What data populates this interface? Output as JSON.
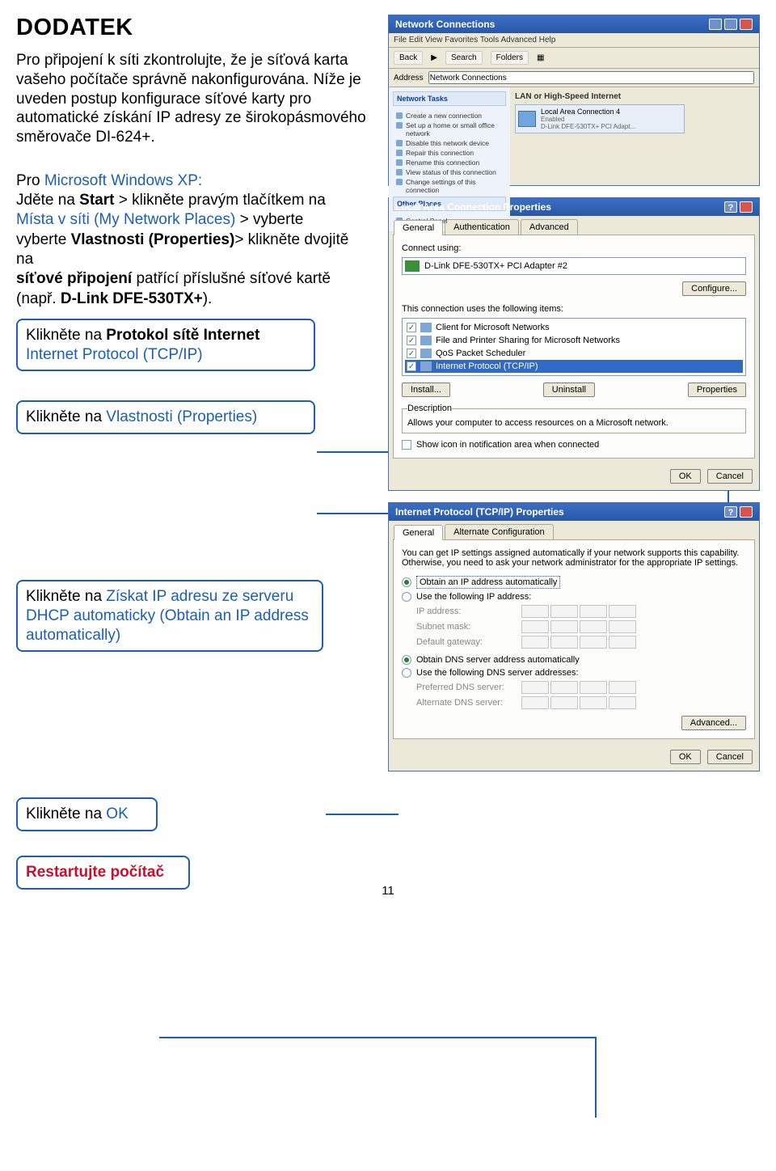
{
  "title": "DODATEK",
  "intro": "Pro připojení k síti zkontrolujte, že je síťová karta vašeho počítače správně nakonfigurována. Níže je uveden postup konfigurace síťové karty pro automatické získání IP adresy ze širokopásmového směrovače DI-624+.",
  "steps": {
    "prefix": "Pro ",
    "os": "Microsoft Windows XP:",
    "l1a": "Jděte na ",
    "start": "Start",
    "l1b": " > klikněte pravým tlačítkem na",
    "mynet": "Místa v síti (My Network Places)",
    "l2": " > vyberte ",
    "props": "Vlastnosti (Properties)",
    "l3": "> klikněte dvojitě na",
    "l4": "síťové připojení",
    "l5": " patřící příslušné síťové kartě (např. ",
    "dlink": "D-Link DFE-530TX+",
    "l6": ")."
  },
  "callouts": {
    "c1a": "Klikněte na ",
    "c1b": "Protokol sítě Internet",
    "c1c": "Internet Protocol (TCP/IP)",
    "c2a": "Klikněte na ",
    "c2b": "Vlastnosti (Properties)",
    "c3a": "Klikněte na ",
    "c3b": "Získat IP adresu ze serveru DHCP automaticky (Obtain an IP address automatically)",
    "c4a": "Klikněte na ",
    "c4b": "OK",
    "c5": "Restartujte počítač"
  },
  "pageno": "11",
  "nc": {
    "title": "Network Connections",
    "menu": "File   Edit   View   Favorites   Tools   Advanced   Help",
    "back": "Back",
    "search": "Search",
    "folders": "Folders",
    "addrlabel": "Address",
    "addrval": "Network Connections",
    "panel1": "Network Tasks",
    "t1": "Create a new connection",
    "t2": "Set up a home or small office network",
    "t3": "Disable this network device",
    "t4": "Repair this connection",
    "t5": "Rename this connection",
    "t6": "View status of this connection",
    "t7": "Change settings of this connection",
    "panel2": "Other Places",
    "p1": "Control Panel",
    "grp": "LAN or High-Speed Internet",
    "conn": "Local Area Connection 4",
    "connstate": "Enabled",
    "adapter": "D-Link DFE-530TX+ PCI Adapt..."
  },
  "lac": {
    "title": "Local Area Connection Properties",
    "tab1": "General",
    "tab2": "Authentication",
    "tab3": "Advanced",
    "connusing": "Connect using:",
    "nic": "D-Link DFE-530TX+ PCI Adapter #2",
    "configure": "Configure...",
    "itemsLabel": "This connection uses the following items:",
    "i1": "Client for Microsoft Networks",
    "i2": "File and Printer Sharing for Microsoft Networks",
    "i3": "QoS Packet Scheduler",
    "i4": "Internet Protocol (TCP/IP)",
    "install": "Install...",
    "uninstall": "Uninstall",
    "properties": "Properties",
    "descLegend": "Description",
    "desc": "Allows your computer to access resources on a Microsoft network.",
    "showicon": "Show icon in notification area when connected",
    "ok": "OK",
    "cancel": "Cancel"
  },
  "tcpip": {
    "title": "Internet Protocol (TCP/IP) Properties",
    "tab1": "General",
    "tab2": "Alternate Configuration",
    "para": "You can get IP settings assigned automatically if your network supports this capability. Otherwise, you need to ask your network administrator for the appropriate IP settings.",
    "r1": "Obtain an IP address automatically",
    "r2": "Use the following IP address:",
    "ip": "IP address:",
    "sub": "Subnet mask:",
    "gw": "Default gateway:",
    "r3": "Obtain DNS server address automatically",
    "r4": "Use the following DNS server addresses:",
    "pdns": "Preferred DNS server:",
    "adns": "Alternate DNS server:",
    "adv": "Advanced...",
    "ok": "OK",
    "cancel": "Cancel"
  }
}
